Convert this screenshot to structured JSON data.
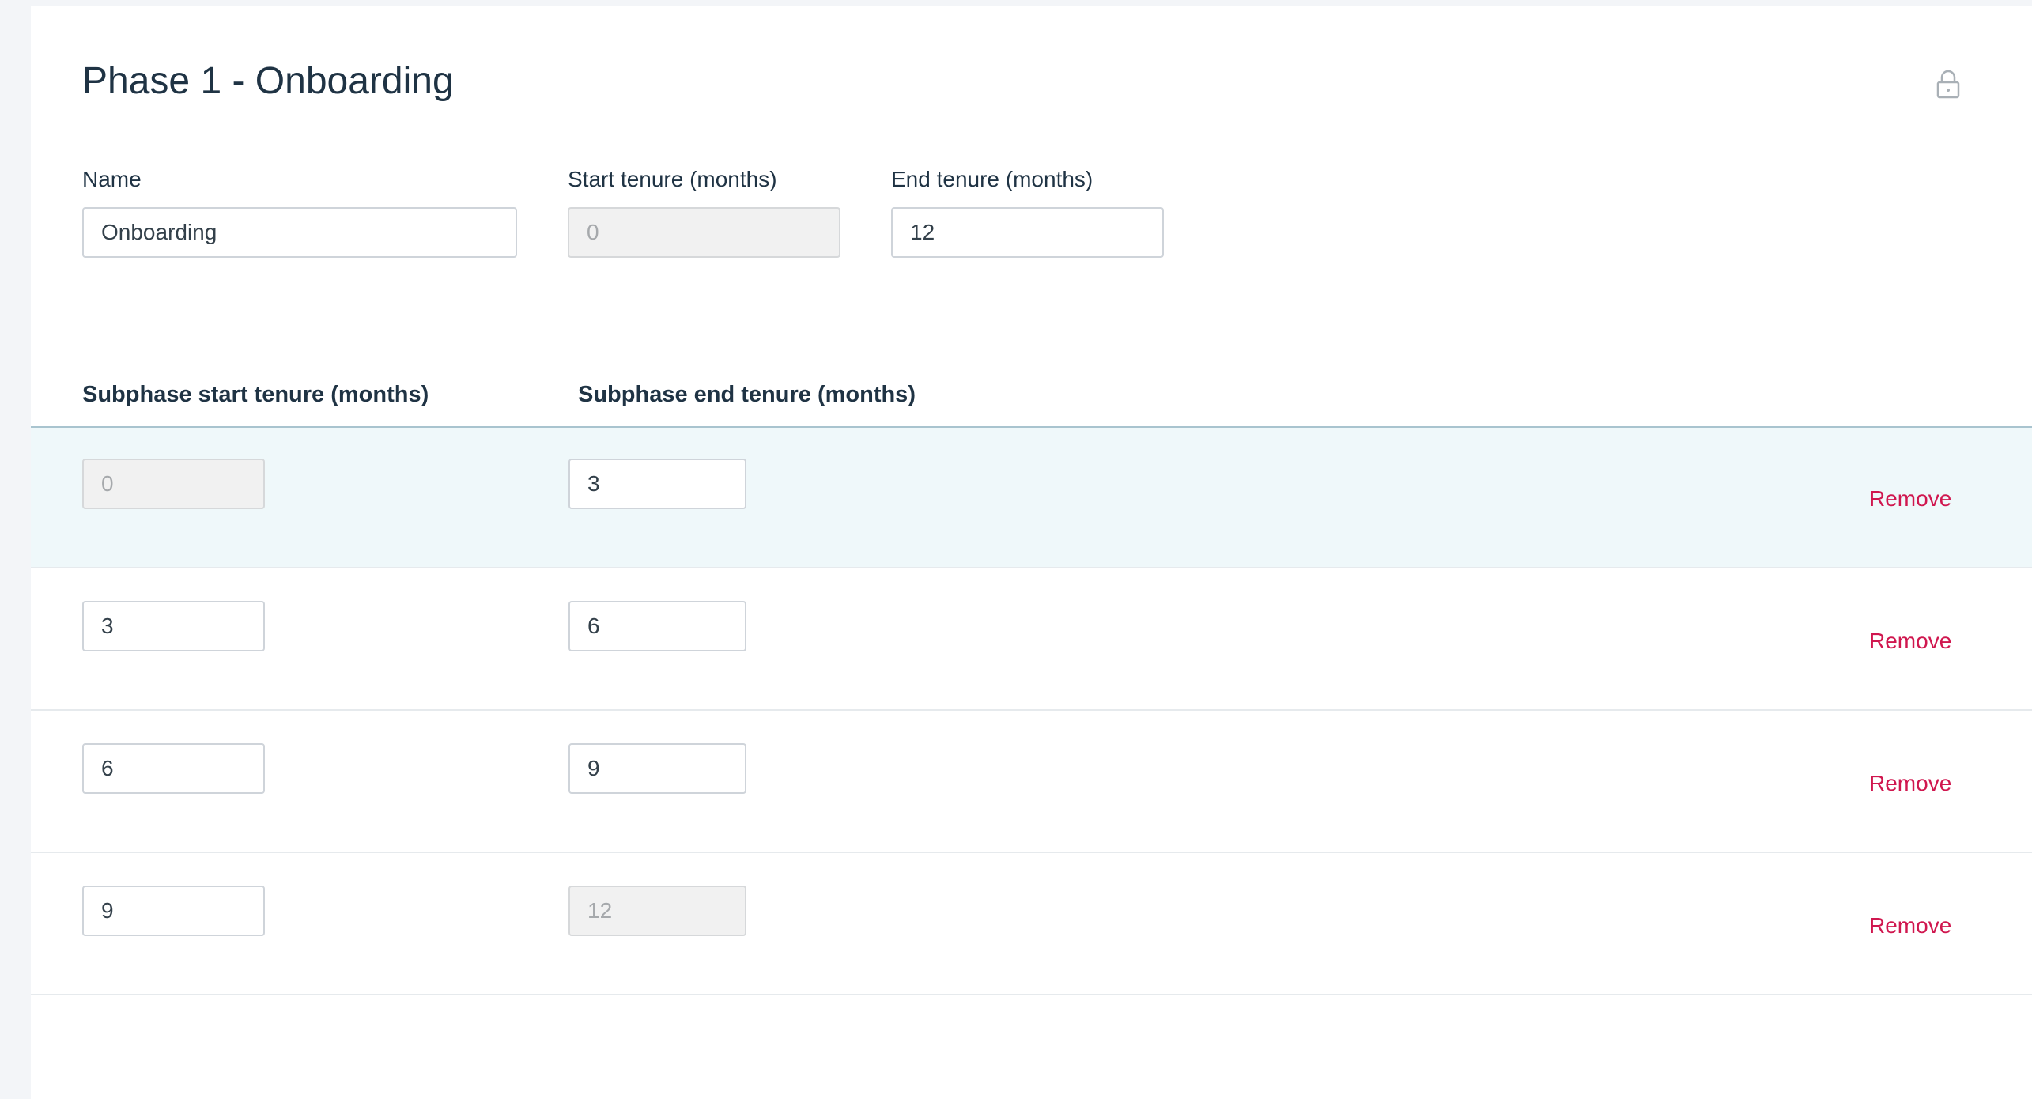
{
  "phase": {
    "title": "Phase 1 - Onboarding",
    "lock_icon": "lock-icon"
  },
  "fields": {
    "name": {
      "label": "Name",
      "value": "Onboarding"
    },
    "start_tenure": {
      "label": "Start tenure (months)",
      "value": "0",
      "disabled": true
    },
    "end_tenure": {
      "label": "End tenure (months)",
      "value": "12"
    }
  },
  "subphases": {
    "headers": {
      "start": "Subphase start tenure (months)",
      "end": "Subphase end tenure (months)"
    },
    "remove_label": "Remove",
    "rows": [
      {
        "start": "0",
        "end": "3",
        "start_disabled": true,
        "end_disabled": false
      },
      {
        "start": "3",
        "end": "6",
        "start_disabled": false,
        "end_disabled": false
      },
      {
        "start": "6",
        "end": "9",
        "start_disabled": false,
        "end_disabled": false
      },
      {
        "start": "9",
        "end": "12",
        "start_disabled": false,
        "end_disabled": true
      }
    ]
  },
  "colors": {
    "remove": "#d0174f",
    "highlight_row": "#eff8fa",
    "title": "#1f3344"
  }
}
